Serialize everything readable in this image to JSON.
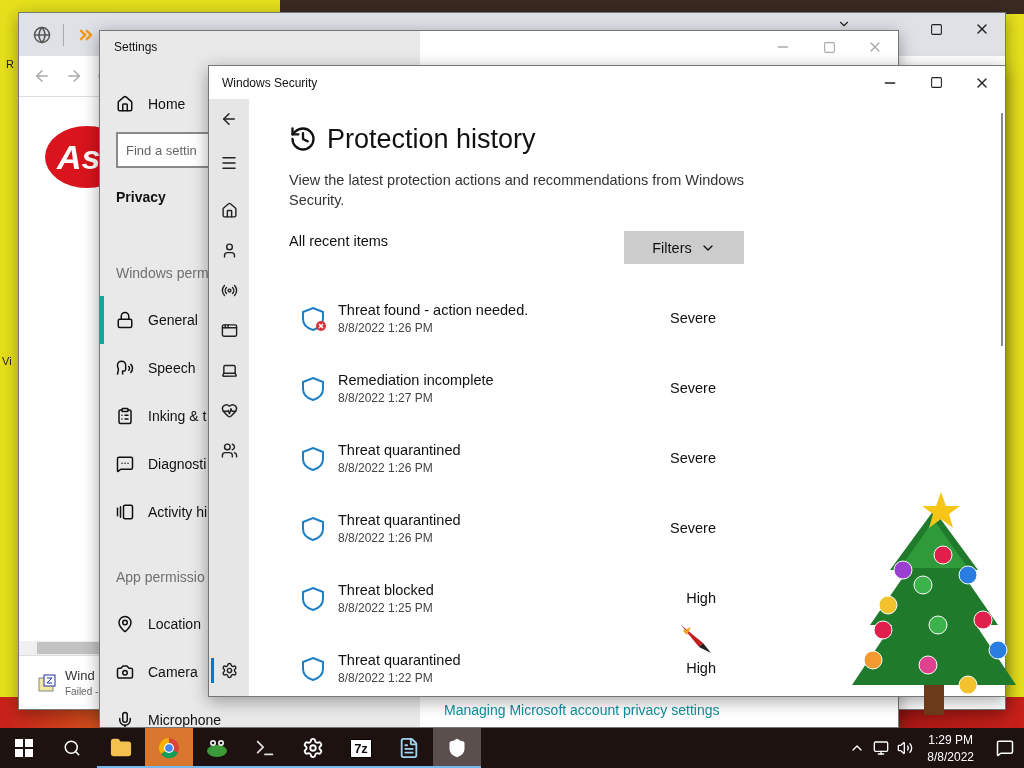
{
  "desktop": {
    "icon_labels": [
      "R",
      "Vi"
    ]
  },
  "browser": {
    "logo_text": "As",
    "download": {
      "name": "Wind",
      "status": "Failed -"
    }
  },
  "settings": {
    "title": "Settings",
    "home": "Home",
    "search": {
      "placeholder": "Find a settin"
    },
    "section": "Privacy",
    "groups": [
      {
        "heading": "Windows perm",
        "items": [
          {
            "label": "General",
            "selected": true
          },
          {
            "label": "Speech",
            "selected": false
          },
          {
            "label": "Inking & t",
            "selected": false
          },
          {
            "label": "Diagnosti",
            "selected": false
          },
          {
            "label": "Activity hi",
            "selected": false
          }
        ]
      },
      {
        "heading": "App permissio",
        "items": [
          {
            "label": "Location",
            "selected": false
          },
          {
            "label": "Camera",
            "selected": false
          },
          {
            "label": "Microphone",
            "selected": false
          }
        ]
      }
    ],
    "footer_link": "Managing Microsoft account privacy settings"
  },
  "security": {
    "title": "Windows Security",
    "nav": [
      {
        "selected": false
      },
      {
        "selected": false
      },
      {
        "selected": false
      },
      {
        "selected": false
      },
      {
        "selected": false
      },
      {
        "selected": false
      },
      {
        "selected": false
      },
      {
        "selected": true
      }
    ],
    "heading": "Protection history",
    "description": "View the latest protection actions and recommendations from Windows Security.",
    "list_label": "All recent items",
    "filter_button": "Filters",
    "items": [
      {
        "title": "Threat found - action needed.",
        "time": "8/8/2022 1:26 PM",
        "severity": "Severe",
        "alert": true
      },
      {
        "title": "Remediation incomplete",
        "time": "8/8/2022 1:27 PM",
        "severity": "Severe",
        "alert": false
      },
      {
        "title": "Threat quarantined",
        "time": "8/8/2022 1:26 PM",
        "severity": "Severe",
        "alert": false
      },
      {
        "title": "Threat quarantined",
        "time": "8/8/2022 1:26 PM",
        "severity": "Severe",
        "alert": false
      },
      {
        "title": "Threat blocked",
        "time": "8/8/2022 1:25 PM",
        "severity": "High",
        "alert": false
      },
      {
        "title": "Threat quarantined",
        "time": "8/8/2022 1:22 PM",
        "severity": "High",
        "alert": false
      }
    ]
  },
  "taskbar": {
    "apps": [
      {
        "running": true,
        "active": false,
        "flashing": false
      },
      {
        "running": true,
        "active": false,
        "flashing": true
      },
      {
        "running": true,
        "active": false,
        "flashing": false
      },
      {
        "running": true,
        "active": false,
        "flashing": false
      },
      {
        "running": true,
        "active": false,
        "flashing": false
      },
      {
        "running": true,
        "active": false,
        "flashing": false,
        "label": "7z"
      },
      {
        "running": true,
        "active": false,
        "flashing": false
      },
      {
        "running": true,
        "active": true,
        "flashing": false
      }
    ],
    "time": "1:29 PM",
    "date": "8/8/2022"
  }
}
